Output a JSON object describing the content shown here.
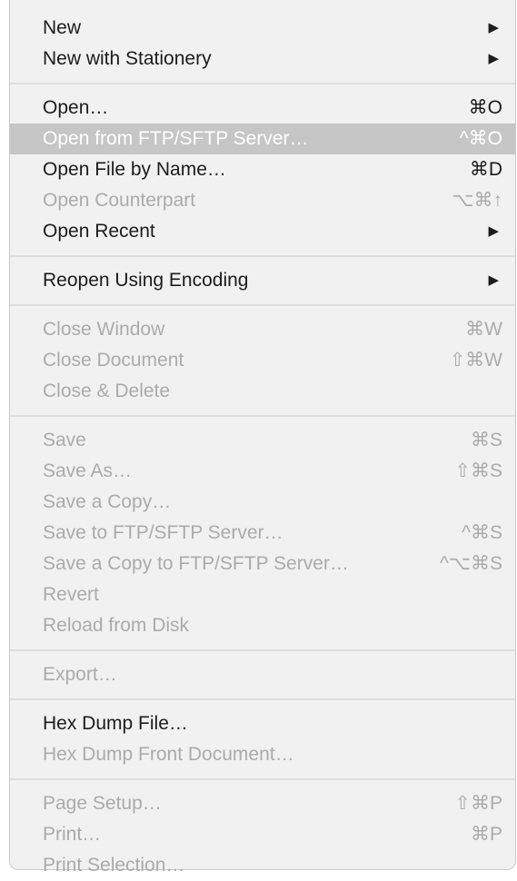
{
  "menu": {
    "groups": [
      {
        "items": [
          {
            "label": "New",
            "shortcut": "",
            "submenu": true,
            "enabled": true,
            "highlighted": false
          },
          {
            "label": "New with Stationery",
            "shortcut": "",
            "submenu": true,
            "enabled": true,
            "highlighted": false
          }
        ]
      },
      {
        "items": [
          {
            "label": "Open…",
            "shortcut": "⌘O",
            "submenu": false,
            "enabled": true,
            "highlighted": false
          },
          {
            "label": "Open from FTP/SFTP Server…",
            "shortcut": "^⌘O",
            "submenu": false,
            "enabled": true,
            "highlighted": true
          },
          {
            "label": "Open File by Name…",
            "shortcut": "⌘D",
            "submenu": false,
            "enabled": true,
            "highlighted": false
          },
          {
            "label": "Open Counterpart",
            "shortcut": "⌥⌘↑",
            "submenu": false,
            "enabled": false,
            "highlighted": false
          },
          {
            "label": "Open Recent",
            "shortcut": "",
            "submenu": true,
            "enabled": true,
            "highlighted": false
          }
        ]
      },
      {
        "items": [
          {
            "label": "Reopen Using Encoding",
            "shortcut": "",
            "submenu": true,
            "enabled": true,
            "highlighted": false
          }
        ]
      },
      {
        "items": [
          {
            "label": "Close Window",
            "shortcut": "⌘W",
            "submenu": false,
            "enabled": false,
            "highlighted": false
          },
          {
            "label": "Close Document",
            "shortcut": "⇧⌘W",
            "submenu": false,
            "enabled": false,
            "highlighted": false
          },
          {
            "label": "Close & Delete",
            "shortcut": "",
            "submenu": false,
            "enabled": false,
            "highlighted": false
          }
        ]
      },
      {
        "items": [
          {
            "label": "Save",
            "shortcut": "⌘S",
            "submenu": false,
            "enabled": false,
            "highlighted": false
          },
          {
            "label": "Save As…",
            "shortcut": "⇧⌘S",
            "submenu": false,
            "enabled": false,
            "highlighted": false
          },
          {
            "label": "Save a Copy…",
            "shortcut": "",
            "submenu": false,
            "enabled": false,
            "highlighted": false
          },
          {
            "label": "Save to FTP/SFTP Server…",
            "shortcut": "^⌘S",
            "submenu": false,
            "enabled": false,
            "highlighted": false
          },
          {
            "label": "Save a Copy to FTP/SFTP Server…",
            "shortcut": "^⌥⌘S",
            "submenu": false,
            "enabled": false,
            "highlighted": false
          },
          {
            "label": "Revert",
            "shortcut": "",
            "submenu": false,
            "enabled": false,
            "highlighted": false
          },
          {
            "label": "Reload from Disk",
            "shortcut": "",
            "submenu": false,
            "enabled": false,
            "highlighted": false
          }
        ]
      },
      {
        "items": [
          {
            "label": "Export…",
            "shortcut": "",
            "submenu": false,
            "enabled": false,
            "highlighted": false
          }
        ]
      },
      {
        "items": [
          {
            "label": "Hex Dump File…",
            "shortcut": "",
            "submenu": false,
            "enabled": true,
            "highlighted": false
          },
          {
            "label": "Hex Dump Front Document…",
            "shortcut": "",
            "submenu": false,
            "enabled": false,
            "highlighted": false
          }
        ]
      },
      {
        "items": [
          {
            "label": "Page Setup…",
            "shortcut": "⇧⌘P",
            "submenu": false,
            "enabled": false,
            "highlighted": false
          },
          {
            "label": "Print…",
            "shortcut": "⌘P",
            "submenu": false,
            "enabled": false,
            "highlighted": false
          },
          {
            "label": "Print Selection…",
            "shortcut": "",
            "submenu": false,
            "enabled": false,
            "highlighted": false
          }
        ]
      }
    ],
    "submenu_icon": "triangle-right-icon",
    "colors": {
      "background": "#f1f1f1",
      "text_enabled": "#1c1c1c",
      "text_disabled": "#ababab",
      "highlight_background": "#c6c6c6",
      "highlight_text": "#ffffff",
      "separator": "#dedede"
    }
  }
}
